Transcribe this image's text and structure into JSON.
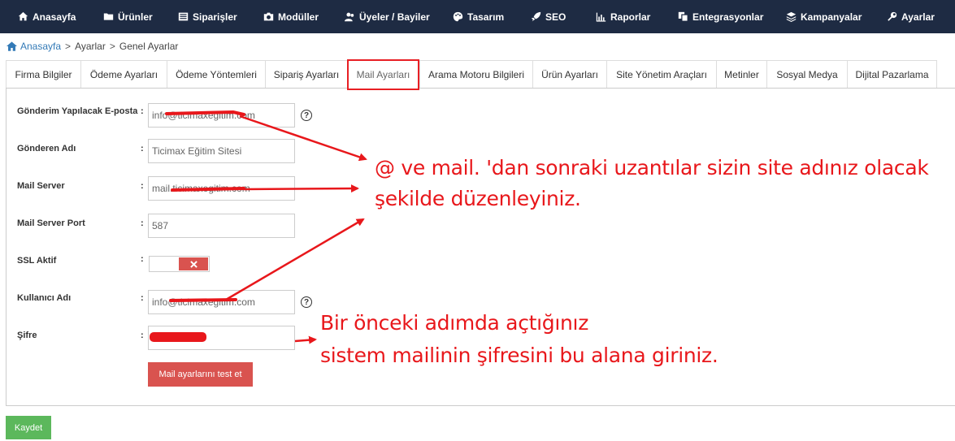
{
  "nav": {
    "items": [
      {
        "label": "Anasayfa",
        "icon": "home-icon"
      },
      {
        "label": "Ürünler",
        "icon": "folder-icon"
      },
      {
        "label": "Siparişler",
        "icon": "list-icon"
      },
      {
        "label": "Modüller",
        "icon": "camera-icon"
      },
      {
        "label": "Üyeler / Bayiler",
        "icon": "users-icon"
      },
      {
        "label": "Tasarım",
        "icon": "palette-icon"
      },
      {
        "label": "SEO",
        "icon": "rocket-icon"
      },
      {
        "label": "Raporlar",
        "icon": "chart-icon"
      },
      {
        "label": "Entegrasyonlar",
        "icon": "copy-icon"
      },
      {
        "label": "Kampanyalar",
        "icon": "stack-icon"
      },
      {
        "label": "Ayarlar",
        "icon": "wrench-icon"
      }
    ]
  },
  "breadcrumb": {
    "home": "Anasayfa",
    "level1": "Ayarlar",
    "level2": "Genel Ayarlar",
    "separator": ">"
  },
  "tabs": [
    {
      "label": "Firma Bilgiler"
    },
    {
      "label": "Ödeme Ayarları"
    },
    {
      "label": "Ödeme Yöntemleri"
    },
    {
      "label": "Sipariş Ayarları"
    },
    {
      "label": "Mail Ayarları",
      "active": true
    },
    {
      "label": "Arama Motoru Bilgileri"
    },
    {
      "label": "Ürün Ayarları"
    },
    {
      "label": "Site Yönetim Araçları"
    },
    {
      "label": "Metinler"
    },
    {
      "label": "Sosyal Medya"
    },
    {
      "label": "Dijital Pazarlama"
    }
  ],
  "form": {
    "colon": ":",
    "help": "?",
    "sender_email": {
      "label": "Gönderim Yapılacak E-posta",
      "value": "info@ticimaxegitim.com"
    },
    "sender_name": {
      "label": "Gönderen Adı",
      "value": "Ticimax Eğitim Sitesi"
    },
    "mail_server": {
      "label": "Mail Server",
      "value": "mail.ticimaxegitim.com"
    },
    "mail_server_port": {
      "label": "Mail Server Port",
      "value": "587"
    },
    "ssl_active": {
      "label": "SSL Aktif",
      "state": "off"
    },
    "username": {
      "label": "Kullanıcı Adı",
      "value": "info@ticimaxegitim.com"
    },
    "password": {
      "label": "Şifre"
    },
    "test_button": "Mail ayarlarını test et"
  },
  "save_button": "Kaydet",
  "annotations": {
    "line1": "@ ve mail. 'dan sonraki uzantılar sizin site adınız olacak",
    "line2": "şekilde düzenleyiniz.",
    "line3": "Bir önceki adımda açtığınız",
    "line4": "sistem mailinin şifresini bu alana giriniz."
  },
  "colors": {
    "nav_bg": "#1e2b43",
    "annotation_red": "#e8171b",
    "test_button": "#d9534f",
    "save_button": "#5cb85c",
    "link": "#337ab7"
  }
}
